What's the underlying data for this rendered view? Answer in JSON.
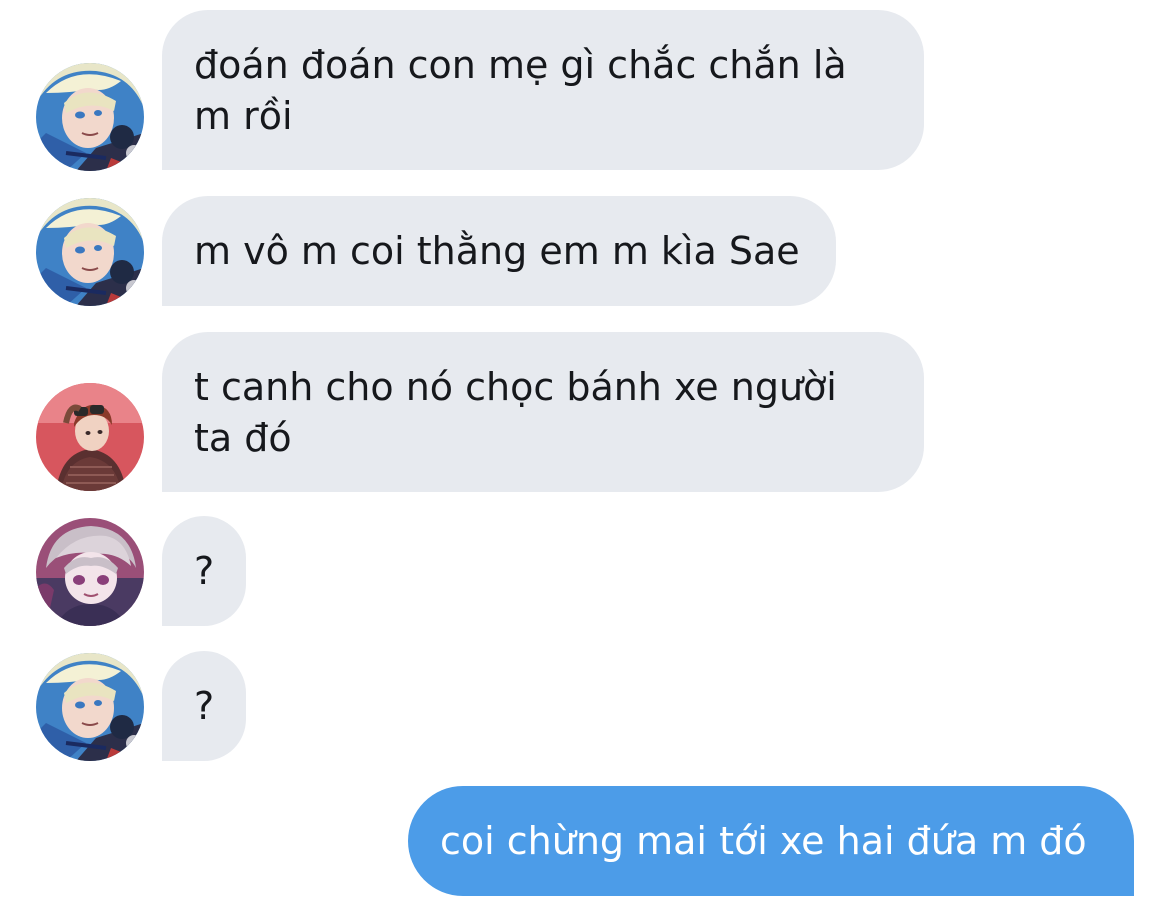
{
  "conversation": {
    "messages": [
      {
        "sender": "blonde-blue-hair",
        "lines": [
          "đoán đoán con mẹ gì chắc chắn là",
          "m rồi"
        ]
      },
      {
        "sender": "blonde-blue-hair",
        "lines": [
          "m vô m coi thằng em m kìa Sae"
        ]
      },
      {
        "sender": "red-hair-goggles",
        "lines": [
          "t canh cho nó chọc bánh xe người",
          "ta đó"
        ]
      },
      {
        "sender": "purple-hair",
        "lines": [
          "?"
        ]
      },
      {
        "sender": "blonde-blue-hair",
        "lines": [
          "?"
        ]
      },
      {
        "sender": "me",
        "lines": [
          "coi chừng mai tới xe hai đứa m đó"
        ]
      }
    ]
  },
  "colors": {
    "incoming_bubble": "#e7eaef",
    "outgoing_bubble": "#4c9ce8",
    "incoming_text": "#16181c",
    "outgoing_text": "#ffffff",
    "background": "#ffffff"
  }
}
